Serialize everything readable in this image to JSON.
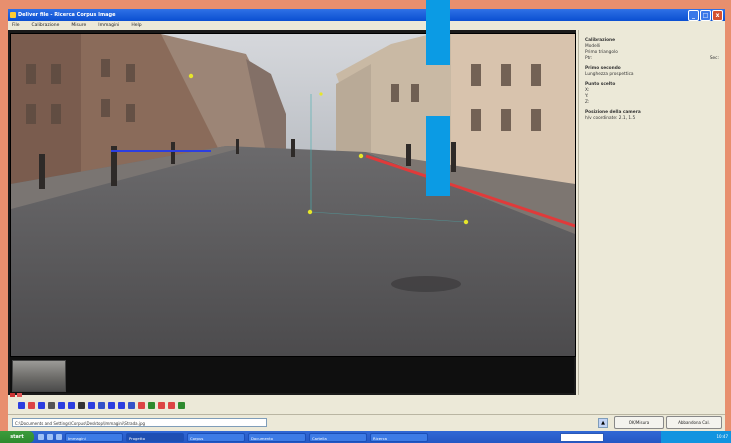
{
  "window": {
    "title": "Deliver file - Ricerca Corpus Image",
    "controls": [
      "_",
      "□",
      "x"
    ]
  },
  "menu": [
    "File",
    "Calibrazione",
    "Misure",
    "Immagini",
    "Help"
  ],
  "side_panel": {
    "sections": [
      {
        "heading": "Calibrazione",
        "lines": [
          "Modelli",
          "Primo triangolo"
        ]
      },
      {
        "heading": "",
        "lines": [
          "Ptr:",
          "Sec:"
        ]
      },
      {
        "heading": "Primo secondo",
        "lines": [
          "Lunghezza prospettica"
        ]
      },
      {
        "heading": "Punto scelto",
        "lines": [
          "X:",
          "Y:",
          "Z:"
        ]
      },
      {
        "heading": "Posizione della camera",
        "lines": [
          "h/v coordinate: 2.1, 1.5"
        ]
      }
    ]
  },
  "statusbar": {
    "path": "C:\\Documents and Settings\\Corpus\\Desktop\\Immagini\\Strada.jpg",
    "ok_button": "OK/Misura",
    "exit_button": "Abbandona Cal."
  },
  "taskbar": {
    "start_label": "start",
    "tasks": [
      "Immagini",
      "Progetto",
      "Corpus",
      "Documento",
      "Cartella",
      "Ricerca"
    ],
    "clock": "10:47"
  },
  "colors": {
    "frame": "#E88F6E",
    "accent_bar": "#0B9BE4",
    "red_line": "#E03A3A",
    "blue_line": "#2C3EE0",
    "yellow_points": "#E6E62A"
  }
}
